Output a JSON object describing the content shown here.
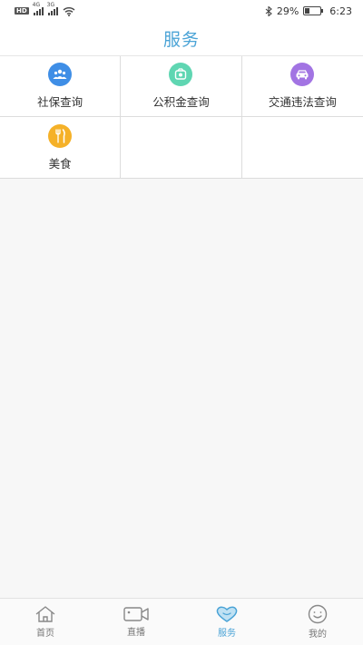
{
  "status_bar": {
    "hd": "HD",
    "net1": "4G",
    "net2": "3G",
    "battery_text": "29%",
    "time": "6:23"
  },
  "header": {
    "title": "服务"
  },
  "services": [
    {
      "label": "社保查询",
      "icon": "people-icon",
      "color": "#3f8ee6"
    },
    {
      "label": "公积金查询",
      "icon": "wallet-icon",
      "color": "#5fd6b2"
    },
    {
      "label": "交通违法查询",
      "icon": "car-icon",
      "color": "#a274e3"
    },
    {
      "label": "美食",
      "icon": "fork-knife-icon",
      "color": "#f5b128"
    }
  ],
  "tabbar": {
    "tabs": [
      {
        "label": "首页",
        "icon": "home-icon",
        "active": false
      },
      {
        "label": "直播",
        "icon": "video-camera-icon",
        "active": false
      },
      {
        "label": "服务",
        "icon": "heart-icon",
        "active": true
      },
      {
        "label": "我的",
        "icon": "smiley-icon",
        "active": false
      }
    ]
  },
  "colors": {
    "accent": "#4aa3d6"
  }
}
